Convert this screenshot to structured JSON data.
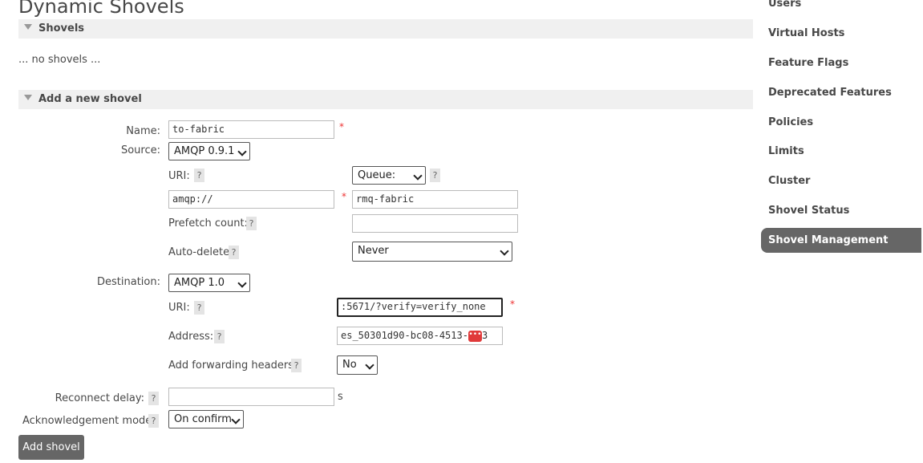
{
  "page_title": "Dynamic Shovels",
  "shovels_section": {
    "title": "Shovels",
    "empty_text": "... no shovels ..."
  },
  "add_section": {
    "title": "Add a new shovel"
  },
  "form": {
    "name": {
      "label": "Name:",
      "value": "to-fabric"
    },
    "source": {
      "label": "Source:",
      "protocol": "AMQP 0.9.1",
      "uri_label": "URI:",
      "uri_value": "amqp://",
      "queue_type": "Queue:",
      "queue_value": "rmq-fabric",
      "prefetch_label": "Prefetch count:",
      "prefetch_value": "",
      "autodelete_label": "Auto-delete",
      "autodelete_value": "Never"
    },
    "destination": {
      "label": "Destination:",
      "protocol": "AMQP 1.0",
      "uri_label": "URI:",
      "uri_value": ":5671/?verify=verify_none",
      "address_label": "Address:",
      "address_value": "es_50301d90-bc08-4513-",
      "address_tail": "3",
      "fwd_label": "Add forwarding headers:",
      "fwd_value": "No"
    },
    "reconnect": {
      "label": "Reconnect delay:",
      "value": "",
      "unit": "s"
    },
    "ack": {
      "label": "Acknowledgement mode:",
      "value": "On confirm"
    },
    "required_mark": "*",
    "help_mark": "?",
    "submit_label": "Add shovel"
  },
  "nav": {
    "items": [
      "Users",
      "Virtual Hosts",
      "Feature Flags",
      "Deprecated Features",
      "Policies",
      "Limits",
      "Cluster",
      "Shovel Status"
    ],
    "active": "Shovel Management"
  },
  "colors": {
    "required": "#ee3333",
    "nav_active_bg": "#666666",
    "section_bg": "#f0f0f0"
  }
}
